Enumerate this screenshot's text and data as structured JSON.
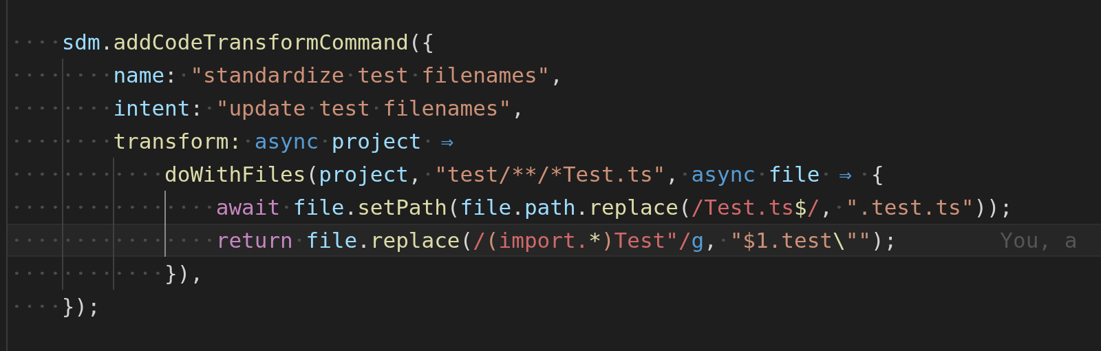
{
  "editor": {
    "lines": [
      {
        "selected": false,
        "tokens": [
          {
            "text": "    sdm",
            "kind": "var"
          },
          {
            "text": ".",
            "kind": "punct"
          },
          {
            "text": "addCodeTransformCommand",
            "kind": "fn"
          },
          {
            "text": "({",
            "kind": "punct"
          }
        ]
      },
      {
        "selected": false,
        "active_guide": false,
        "tokens": [
          {
            "text": "        name",
            "kind": "var"
          },
          {
            "text": ": ",
            "kind": "punct"
          },
          {
            "text": "\"standardize test filenames\"",
            "kind": "str"
          },
          {
            "text": ",",
            "kind": "punct"
          }
        ]
      },
      {
        "selected": false,
        "active_guide": false,
        "tokens": [
          {
            "text": "        intent",
            "kind": "var"
          },
          {
            "text": ": ",
            "kind": "punct"
          },
          {
            "text": "\"update test filenames\"",
            "kind": "str"
          },
          {
            "text": ",",
            "kind": "punct"
          }
        ]
      },
      {
        "selected": false,
        "active_guide": false,
        "tokens": [
          {
            "text": "        transform",
            "kind": "fn"
          },
          {
            "text": ": ",
            "kind": "fn"
          },
          {
            "text": "async ",
            "kind": "kw"
          },
          {
            "text": "project ",
            "kind": "var"
          },
          {
            "text": "⇒",
            "kind": "arrow"
          }
        ]
      },
      {
        "selected": false,
        "active_guide": false,
        "tokens": [
          {
            "text": "            doWithFiles",
            "kind": "fn"
          },
          {
            "text": "(",
            "kind": "punct"
          },
          {
            "text": "project",
            "kind": "var"
          },
          {
            "text": ", ",
            "kind": "punct"
          },
          {
            "text": "\"test/**/*Test.ts\"",
            "kind": "str"
          },
          {
            "text": ", ",
            "kind": "punct"
          },
          {
            "text": "async ",
            "kind": "kw"
          },
          {
            "text": "file ",
            "kind": "var"
          },
          {
            "text": "⇒",
            "kind": "arrow"
          },
          {
            "text": " {",
            "kind": "punct"
          }
        ]
      },
      {
        "selected": false,
        "active_guide": true,
        "tokens": [
          {
            "text": "                await ",
            "kind": "ctrl"
          },
          {
            "text": "file",
            "kind": "var"
          },
          {
            "text": ".",
            "kind": "punct"
          },
          {
            "text": "setPath",
            "kind": "fn"
          },
          {
            "text": "(",
            "kind": "punct"
          },
          {
            "text": "file",
            "kind": "var"
          },
          {
            "text": ".",
            "kind": "punct"
          },
          {
            "text": "path",
            "kind": "var"
          },
          {
            "text": ".",
            "kind": "punct"
          },
          {
            "text": "replace",
            "kind": "fn"
          },
          {
            "text": "(",
            "kind": "punct"
          },
          {
            "text": "/Test.ts",
            "kind": "regex"
          },
          {
            "text": "$",
            "kind": "anchor"
          },
          {
            "text": "/",
            "kind": "regex"
          },
          {
            "text": ", ",
            "kind": "punct"
          },
          {
            "text": "\".test.ts\"",
            "kind": "str"
          },
          {
            "text": "));",
            "kind": "punct"
          }
        ]
      },
      {
        "selected": true,
        "active_guide": true,
        "blame": "You, a",
        "tokens": [
          {
            "text": "                return ",
            "kind": "ctrl"
          },
          {
            "text": "file",
            "kind": "var"
          },
          {
            "text": ".",
            "kind": "punct"
          },
          {
            "text": "replace",
            "kind": "fn"
          },
          {
            "text": "(",
            "kind": "punct"
          },
          {
            "text": "/",
            "kind": "regex"
          },
          {
            "text": "(",
            "kind": "str"
          },
          {
            "text": "import.",
            "kind": "regex"
          },
          {
            "text": "*",
            "kind": "anchor"
          },
          {
            "text": ")",
            "kind": "str"
          },
          {
            "text": "Test\"/",
            "kind": "regex"
          },
          {
            "text": "g",
            "kind": "kw"
          },
          {
            "text": ", ",
            "kind": "punct"
          },
          {
            "text": "\"$1.test",
            "kind": "str"
          },
          {
            "text": "\\",
            "kind": "anchor"
          },
          {
            "text": "\"\"",
            "kind": "str"
          },
          {
            "text": ");",
            "kind": "punct"
          }
        ]
      },
      {
        "selected": false,
        "active_guide": false,
        "tokens": [
          {
            "text": "            }),",
            "kind": "punct"
          }
        ]
      },
      {
        "selected": false,
        "tokens": [
          {
            "text": "    });",
            "kind": "punct"
          }
        ]
      }
    ]
  }
}
